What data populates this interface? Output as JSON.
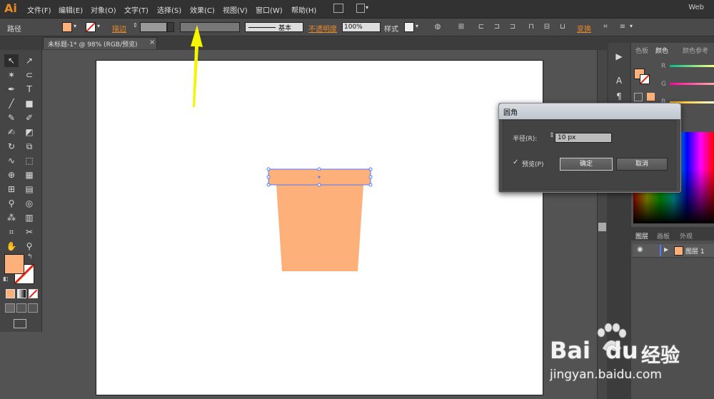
{
  "app": {
    "logo": "Ai",
    "workspace": "Web"
  },
  "menu": [
    "文件(F)",
    "编辑(E)",
    "对象(O)",
    "文字(T)",
    "选择(S)",
    "效果(C)",
    "视图(V)",
    "窗口(W)",
    "帮助(H)"
  ],
  "control": {
    "selection_label": "路径",
    "stroke_label": "描边",
    "brush_label": "基本",
    "opacity_label": "不透明度",
    "opacity_value": "100%",
    "style_label": "样式",
    "transform_label": "变换",
    "fill_color": "#fdb07a"
  },
  "document": {
    "tab_title": "未标题-1* @ 98% (RGB/预览)",
    "close": "×"
  },
  "shape": {
    "color": "#fdb07a"
  },
  "dialog": {
    "title": "圆角",
    "radius_label": "半径(R):",
    "radius_value": "10 px",
    "preview_label": "预览(P)",
    "check_mark": "✓",
    "ok_label": "确定",
    "cancel_label": "取消"
  },
  "panels": {
    "color_tabs": [
      "色板",
      "颜色",
      "颜色参考"
    ],
    "channels": [
      "R",
      "G",
      "B"
    ],
    "layer_tabs": [
      "图层",
      "画板",
      "外观"
    ],
    "layer_name": "图层 1"
  },
  "watermark": {
    "brand": "Bai",
    "brand2": "du",
    "product": "经验",
    "url": "jingyan.baidu.com"
  }
}
